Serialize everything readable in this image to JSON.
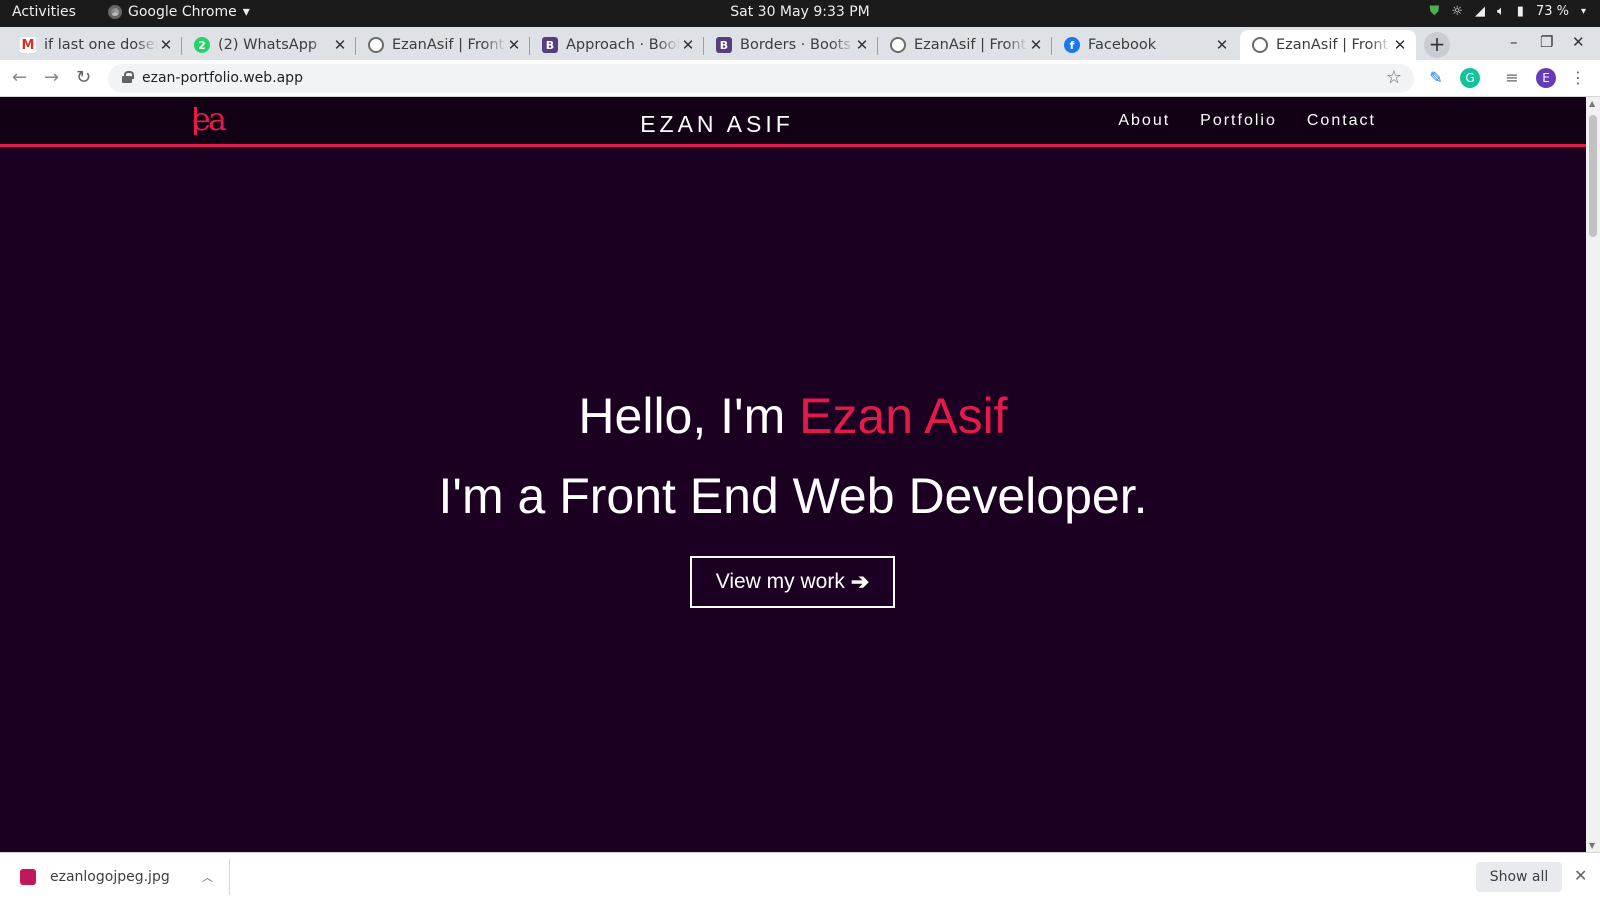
{
  "system_bar": {
    "activities": "Activities",
    "app_name": "Google Chrome",
    "clock": "Sat 30 May  9:33 PM",
    "battery": "73 %"
  },
  "tabs": [
    {
      "title": "if last one dosen",
      "icon": "gmail-icon"
    },
    {
      "title": "(2) WhatsApp",
      "icon": "whatsapp-icon"
    },
    {
      "title": "EzanAsif | Front",
      "icon": "globe-icon"
    },
    {
      "title": "Approach · Boot",
      "icon": "bootstrap-icon"
    },
    {
      "title": "Borders · Boots",
      "icon": "bootstrap-icon"
    },
    {
      "title": "EzanAsif | Front",
      "icon": "globe-icon"
    },
    {
      "title": "Facebook",
      "icon": "facebook-icon"
    },
    {
      "title": "EzanAsif | Front",
      "icon": "globe-icon",
      "active": true
    }
  ],
  "address_bar": {
    "url": "ezan-portfolio.web.app"
  },
  "site": {
    "logo_text": "ea",
    "brand": "EZAN ASIF",
    "nav": {
      "about": "About",
      "portfolio": "Portfolio",
      "contact": "Contact"
    },
    "hero": {
      "greeting": "Hello, I'm ",
      "name": "Ezan Asif",
      "tagline": "I'm a Front End Web Developer.",
      "cta_label": "View my work"
    }
  },
  "downloads": {
    "file_name": "ezanlogojpeg.jpg",
    "show_all": "Show all"
  },
  "colors": {
    "accent": "#e31b4b",
    "background": "#1b0022",
    "navbar": "#120014"
  }
}
